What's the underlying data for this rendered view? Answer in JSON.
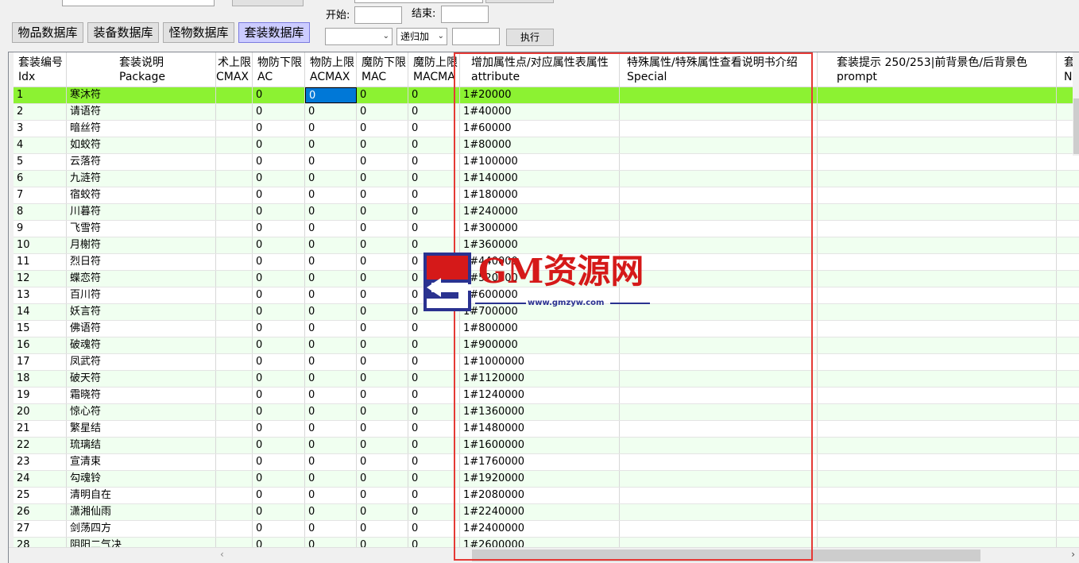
{
  "toolbar": {
    "tabs": [
      {
        "label": "物品数据库",
        "active": false
      },
      {
        "label": "装备数据库",
        "active": false
      },
      {
        "label": "怪物数据库",
        "active": false
      },
      {
        "label": "套装数据库",
        "active": true
      }
    ],
    "start_label": "开始:",
    "end_label": "结束:",
    "start_value": "",
    "end_value": "",
    "field_select": "",
    "mode_select": "递归加",
    "increment_value": "",
    "execute_label": "执行"
  },
  "grid": {
    "columns": [
      {
        "cn": "套装编号",
        "en": "Idx"
      },
      {
        "cn": "套装说明",
        "en": "Package"
      },
      {
        "cn": "术上限",
        "en": "CMAX"
      },
      {
        "cn": "物防下限",
        "en": "AC"
      },
      {
        "cn": "物防上限",
        "en": "ACMAX"
      },
      {
        "cn": "魔防下限",
        "en": "MAC"
      },
      {
        "cn": "魔防上限",
        "en": "MACMA"
      },
      {
        "cn": "增加属性点/对应属性表属性",
        "en": "attribute"
      },
      {
        "cn": "特殊属性/特殊属性查看说明书介绍",
        "en": "Special"
      },
      {
        "cn": "套装提示 250/253|前背景色/后背景色",
        "en": "prompt"
      },
      {
        "cn": "套",
        "en": "N"
      }
    ],
    "rows": [
      {
        "idx": "1",
        "name": "寒沐符",
        "cmax": "",
        "ac": "0",
        "acmax": "0",
        "mac": "0",
        "macmax": "0",
        "attribute": "1#20000",
        "special": "",
        "prompt": ""
      },
      {
        "idx": "2",
        "name": "请语符",
        "cmax": "",
        "ac": "0",
        "acmax": "0",
        "mac": "0",
        "macmax": "0",
        "attribute": "1#40000",
        "special": "",
        "prompt": ""
      },
      {
        "idx": "3",
        "name": "暗丝符",
        "cmax": "",
        "ac": "0",
        "acmax": "0",
        "mac": "0",
        "macmax": "0",
        "attribute": "1#60000",
        "special": "",
        "prompt": ""
      },
      {
        "idx": "4",
        "name": "如蛟符",
        "cmax": "",
        "ac": "0",
        "acmax": "0",
        "mac": "0",
        "macmax": "0",
        "attribute": "1#80000",
        "special": "",
        "prompt": ""
      },
      {
        "idx": "5",
        "name": "云落符",
        "cmax": "",
        "ac": "0",
        "acmax": "0",
        "mac": "0",
        "macmax": "0",
        "attribute": "1#100000",
        "special": "",
        "prompt": ""
      },
      {
        "idx": "6",
        "name": "九涟符",
        "cmax": "",
        "ac": "0",
        "acmax": "0",
        "mac": "0",
        "macmax": "0",
        "attribute": "1#140000",
        "special": "",
        "prompt": ""
      },
      {
        "idx": "7",
        "name": "宿蛟符",
        "cmax": "",
        "ac": "0",
        "acmax": "0",
        "mac": "0",
        "macmax": "0",
        "attribute": "1#180000",
        "special": "",
        "prompt": ""
      },
      {
        "idx": "8",
        "name": "川暮符",
        "cmax": "",
        "ac": "0",
        "acmax": "0",
        "mac": "0",
        "macmax": "0",
        "attribute": "1#240000",
        "special": "",
        "prompt": ""
      },
      {
        "idx": "9",
        "name": "飞雪符",
        "cmax": "",
        "ac": "0",
        "acmax": "0",
        "mac": "0",
        "macmax": "0",
        "attribute": "1#300000",
        "special": "",
        "prompt": ""
      },
      {
        "idx": "10",
        "name": "月榭符",
        "cmax": "",
        "ac": "0",
        "acmax": "0",
        "mac": "0",
        "macmax": "0",
        "attribute": "1#360000",
        "special": "",
        "prompt": ""
      },
      {
        "idx": "11",
        "name": "烈日符",
        "cmax": "",
        "ac": "0",
        "acmax": "0",
        "mac": "0",
        "macmax": "0",
        "attribute": "1#440000",
        "special": "",
        "prompt": ""
      },
      {
        "idx": "12",
        "name": "蝶恋符",
        "cmax": "",
        "ac": "0",
        "acmax": "0",
        "mac": "0",
        "macmax": "0",
        "attribute": "1#520000",
        "special": "",
        "prompt": ""
      },
      {
        "idx": "13",
        "name": "百川符",
        "cmax": "",
        "ac": "0",
        "acmax": "0",
        "mac": "0",
        "macmax": "0",
        "attribute": "1#600000",
        "special": "",
        "prompt": ""
      },
      {
        "idx": "14",
        "name": "妖言符",
        "cmax": "",
        "ac": "0",
        "acmax": "0",
        "mac": "0",
        "macmax": "0",
        "attribute": "1#700000",
        "special": "",
        "prompt": ""
      },
      {
        "idx": "15",
        "name": "佛语符",
        "cmax": "",
        "ac": "0",
        "acmax": "0",
        "mac": "0",
        "macmax": "0",
        "attribute": "1#800000",
        "special": "",
        "prompt": ""
      },
      {
        "idx": "16",
        "name": "破魂符",
        "cmax": "",
        "ac": "0",
        "acmax": "0",
        "mac": "0",
        "macmax": "0",
        "attribute": "1#900000",
        "special": "",
        "prompt": ""
      },
      {
        "idx": "17",
        "name": "凤武符",
        "cmax": "",
        "ac": "0",
        "acmax": "0",
        "mac": "0",
        "macmax": "0",
        "attribute": "1#1000000",
        "special": "",
        "prompt": ""
      },
      {
        "idx": "18",
        "name": "破天符",
        "cmax": "",
        "ac": "0",
        "acmax": "0",
        "mac": "0",
        "macmax": "0",
        "attribute": "1#1120000",
        "special": "",
        "prompt": ""
      },
      {
        "idx": "19",
        "name": "霜晓符",
        "cmax": "",
        "ac": "0",
        "acmax": "0",
        "mac": "0",
        "macmax": "0",
        "attribute": "1#1240000",
        "special": "",
        "prompt": ""
      },
      {
        "idx": "20",
        "name": "惊心符",
        "cmax": "",
        "ac": "0",
        "acmax": "0",
        "mac": "0",
        "macmax": "0",
        "attribute": "1#1360000",
        "special": "",
        "prompt": ""
      },
      {
        "idx": "21",
        "name": "繁星结",
        "cmax": "",
        "ac": "0",
        "acmax": "0",
        "mac": "0",
        "macmax": "0",
        "attribute": "1#1480000",
        "special": "",
        "prompt": ""
      },
      {
        "idx": "22",
        "name": "琉璃结",
        "cmax": "",
        "ac": "0",
        "acmax": "0",
        "mac": "0",
        "macmax": "0",
        "attribute": "1#1600000",
        "special": "",
        "prompt": ""
      },
      {
        "idx": "23",
        "name": "宣清束",
        "cmax": "",
        "ac": "0",
        "acmax": "0",
        "mac": "0",
        "macmax": "0",
        "attribute": "1#1760000",
        "special": "",
        "prompt": ""
      },
      {
        "idx": "24",
        "name": "勾魂铃",
        "cmax": "",
        "ac": "0",
        "acmax": "0",
        "mac": "0",
        "macmax": "0",
        "attribute": "1#1920000",
        "special": "",
        "prompt": ""
      },
      {
        "idx": "25",
        "name": "清明自在",
        "cmax": "",
        "ac": "0",
        "acmax": "0",
        "mac": "0",
        "macmax": "0",
        "attribute": "1#2080000",
        "special": "",
        "prompt": ""
      },
      {
        "idx": "26",
        "name": "潇湘仙雨",
        "cmax": "",
        "ac": "0",
        "acmax": "0",
        "mac": "0",
        "macmax": "0",
        "attribute": "1#2240000",
        "special": "",
        "prompt": ""
      },
      {
        "idx": "27",
        "name": "剑荡四方",
        "cmax": "",
        "ac": "0",
        "acmax": "0",
        "mac": "0",
        "macmax": "0",
        "attribute": "1#2400000",
        "special": "",
        "prompt": ""
      },
      {
        "idx": "28",
        "name": "阴阳二气决",
        "cmax": "",
        "ac": "0",
        "acmax": "0",
        "mac": "0",
        "macmax": "0",
        "attribute": "1#2600000",
        "special": "",
        "prompt": ""
      }
    ]
  },
  "watermark": {
    "text": "GM资源网",
    "url": "www.gmzyw.com"
  },
  "colors": {
    "selected_row": "#8cf232",
    "alt_row": "#f0fff0",
    "annotation": "#e53935",
    "active_tab": "#ccccff"
  }
}
